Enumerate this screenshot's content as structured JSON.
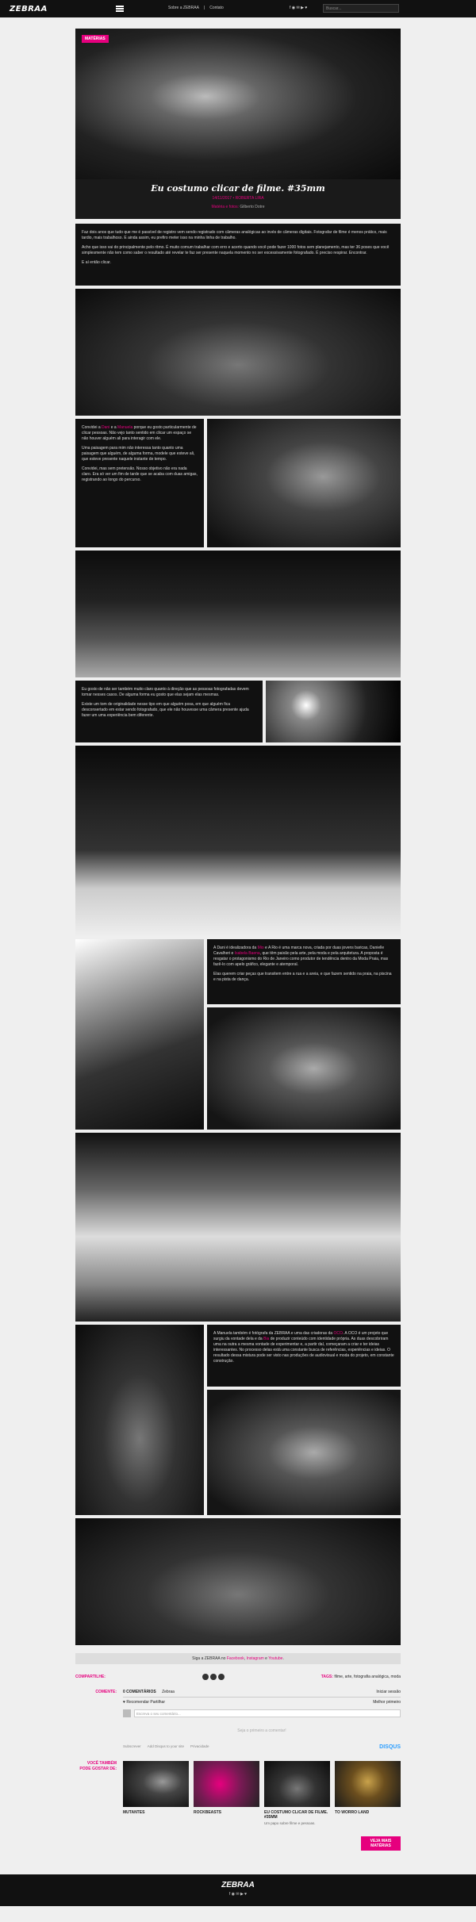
{
  "nav": {
    "logo": "ZEBRAA",
    "links": [
      "Sobre a ZEBRAA",
      "|",
      "Contato"
    ],
    "social": "f ◉ ✉ ▶ ♥",
    "search_placeholder": "Buscar..."
  },
  "hero": {
    "tag": "MATÉRIAS",
    "title": "Eu costumo clicar de filme. #35mm",
    "meta": "14/11/2017 • ROBERTA LIRA",
    "credit_prefix": "Matéria e fotos:",
    "credit_name": "Gilberto Dotre"
  },
  "intro": {
    "p1": "Faz dois anos que tudo que me é passível de registro vem sendo registrado com câmeras analógicas ao invés de câmeras digitais. Fotografar de filme é menos prático, mais tardio, mais trabalhoso. E ainda assim, eu prefiro meter isso na minha linha de trabalho.",
    "p2": "Acho que isso vai do principalmente pelo ritmo. É muito comum trabalhar com erro e acerto quando você pode fazer 1000 fotos sem planejamento, mas ter 36 poses que você simplesmente não tem como saber o resultado até revelar te faz ser presente naquela momento no ser excessivamente fotografado. É preciso respirar. Encontrar.",
    "p3": "E aí então clicar."
  },
  "block2": {
    "p1_a": "Convidei a ",
    "p1_link1": "Dani",
    "p1_b": " e a ",
    "p1_link2": "Manuela",
    "p1_c": " porque eu gosto particularmente de clicar pessoas. Não vejo tanto sentido em clicar um espaço se não houver alguém ali para interagir com ele.",
    "p2": "Uma paisagem para mim não interessa tanto quanto uma paisagem que alguém, de alguma forma, modele que esteve ali, que esteve presente naquele instante de tempo.",
    "p3": "Convidei, mas sem pretensão. Nosso objetivo não era nada claro. Era só ver um fim de tarde que se acaba com duas amigas, registrando ao longo do percurso."
  },
  "block3": {
    "p1": "Eu gosto de não ser também muito claro quanto à direção que as pessoas fotografadas devem tomar nesses casos. De alguma forma eu gosto que elas sejam elas mesmas.",
    "p2": "Existe um tom de originalidade nesse tipo em que alguém posa, em que alguém fica desconsertado em estar sendo fotografado, que ele não houvesse uma câmera presente ajuda fazer um uma experiência bem diferente."
  },
  "block4": {
    "p1_a": "A Dani é idealizadora da ",
    "p1_link1": "Mio",
    "p1_b": " e A Rio é uma marca nova, criada por duas jovens baricas, Danielle Cavalheri e ",
    "p1_link2": "Isabela Baena",
    "p1_c": ", que têm paixão pela arte, pela moda e pela arquitetura. A proposta é resgatar o protagonismo do Rio de Janeiro como produtor de tendência dentro da Moda Praia, mas fazê-lo com apelo gráfico, elegante e atemporal.",
    "p2": "Elas querem criar peças que transitem entre a rua e a areia, e que fazem sentido na praia, na piscina e na pista de dança."
  },
  "block5": {
    "p1_a": "A Manuela também é fotógrafa da ZEBRAA e uma das criadoras da ",
    "p1_link1": "OCO",
    "p1_b": ". A OCO é um projeto que surgiu da vontade dela e da ",
    "p1_link2": "Bia",
    "p1_c": " de produzir conteúdo com identidade própria. As duas descobriram uma na outra a mesma vontade de experimentar e, a partir daí, começaram a criar e ter ideias interessantes. No processo delas está uma constante busca de referências, experiências e ideias. O resultado dessa mistura pode ser visto nas produções de audiovisual e moda do projeto, em constante construção."
  },
  "cta": {
    "prefix": "Siga a ZEBRAA no ",
    "facebook": "Facebook",
    "sep1": ", ",
    "instagram": "Instagram",
    "sep2": " e ",
    "youtube": "Youtube",
    "suffix": "."
  },
  "share": {
    "label": "COMPARTILHE:",
    "tags_label": "TAGS:",
    "tags": "filme, arte, fotografia analógica, moda"
  },
  "comments": {
    "label": "COMENTE:",
    "tab1": "0 COMENTÁRIOS",
    "tab2": "Zebraa",
    "login": "Iniciar sessão",
    "recommend": "♥ Recomendar",
    "share": "Partilhar",
    "sort": "Melhor primeiro",
    "input_placeholder": "Escreva o seu comentário...",
    "empty": "Seja o primeiro a comentar!",
    "subscribe": "Subscrever",
    "add_disqus": "Add Disqus to your site",
    "privacy": "Privacidade",
    "disqus": "DISQUS"
  },
  "related": {
    "label": "VOCÊ TAMBÉM PODE GOSTAR DE:",
    "cards": [
      {
        "title": "MUTANTES",
        "sub": ""
      },
      {
        "title": "ROCKBEASTS",
        "sub": ""
      },
      {
        "title": "EU COSTUMO CLICAR DE FILME. #35MM",
        "sub": "Um papo sobre filme e pessoas."
      },
      {
        "title": "TO WORRO LAND",
        "sub": ""
      }
    ],
    "more": "VEJA MAIS MATÉRIAS"
  },
  "footer": {
    "logo": "ZEBRAA",
    "social": "f ◉ ✉ ▶ ♥"
  },
  "colors": {
    "accent": "#e6007e",
    "dark": "#111111",
    "bg": "#efefef"
  }
}
